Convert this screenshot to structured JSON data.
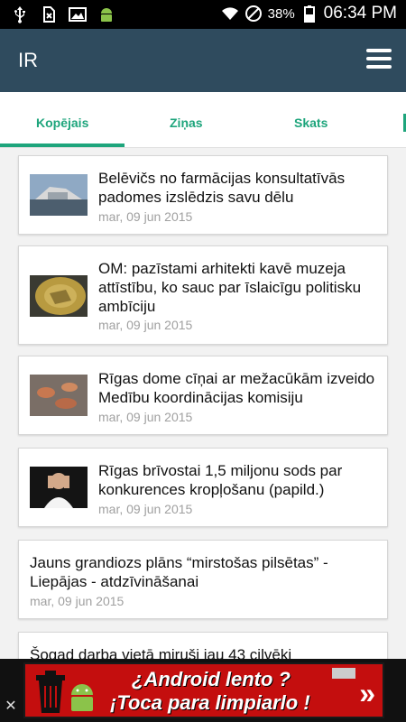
{
  "status_bar": {
    "battery": "38%",
    "time": "06:34 PM"
  },
  "app_bar": {
    "title": "IR",
    "menu_icon": "hamburger-icon"
  },
  "tabs": [
    {
      "label": "Kopējais",
      "selected": true
    },
    {
      "label": "Ziņas"
    },
    {
      "label": "Skats"
    }
  ],
  "articles": [
    {
      "headline": "Belēvičs no farmācijas konsultatīvās padomes izslēdzis savu dēlu",
      "date": "mar, 09 jun 2015"
    },
    {
      "headline": "OM: pazīstami arhitekti kavē muzeja attīstību, ko sauc par īslaicīgu politisku ambīciju",
      "date": "mar, 09 jun 2015"
    },
    {
      "headline": "Rīgas dome cīņai ar mežacūkām izveido Medību koordinācijas komisiju",
      "date": "mar, 09 jun 2015"
    },
    {
      "headline": "Rīgas brīvostai 1,5 miljonu sods par konkurences kropļošanu (papild.)",
      "date": "mar, 09 jun 2015"
    },
    {
      "headline": "Jauns grandiozs plāns “mirstošas pilsētas” - Liepājas - atdzīvināšanai",
      "date": "mar, 09 jun 2015"
    },
    {
      "headline": "Šogad darba vietā miruši jau 43 cilvēki"
    }
  ],
  "ad": {
    "line1": "¿Android lento ?",
    "line2": "¡Toca para limpiarlo !",
    "arrow": "»",
    "close": "✕"
  },
  "colors": {
    "appbar": "#2f4b5e",
    "accent": "#1ea57c",
    "ad_background": "#c40e0e"
  }
}
